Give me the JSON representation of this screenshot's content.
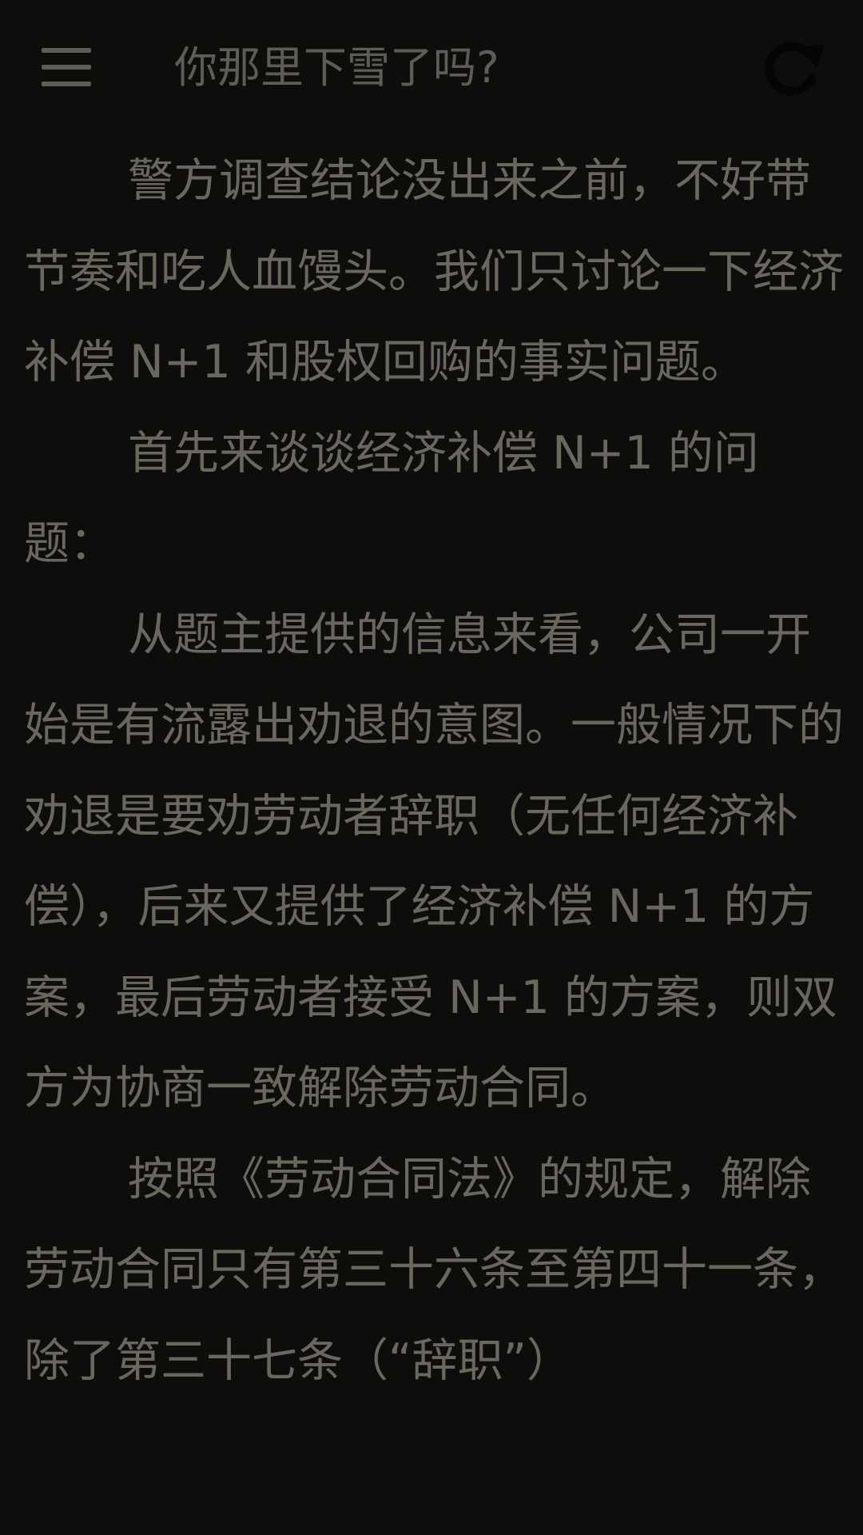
{
  "header": {
    "menu_icon": "hamburger-menu-icon",
    "title": "你那里下雪了吗?",
    "refresh_icon": "refresh-icon"
  },
  "article": {
    "paragraphs": [
      "警方调查结论没出来之前，不好带节奏和吃人血馒头。我们只讨论一下经济补偿 N+1 和股权回购的事实问题。",
      "首先来谈谈经济补偿 N+1 的问题：",
      "从题主提供的信息来看，公司一开始是有流露出劝退的意图。一般情况下的劝退是要劝劳动者辞职（无任何经济补偿），后来又提供了经济补偿 N+1 的方案，最后劳动者接受 N+1 的方案，则双方为协商一致解除劳动合同。",
      "按照《劳动合同法》的规定，解除劳动合同只有第三十六条至第四十一条，除了第三十七条（“辞职”）"
    ]
  },
  "colors": {
    "background": "#0d0d0c",
    "text": "#6b675e",
    "icon": "#5f5c55"
  }
}
